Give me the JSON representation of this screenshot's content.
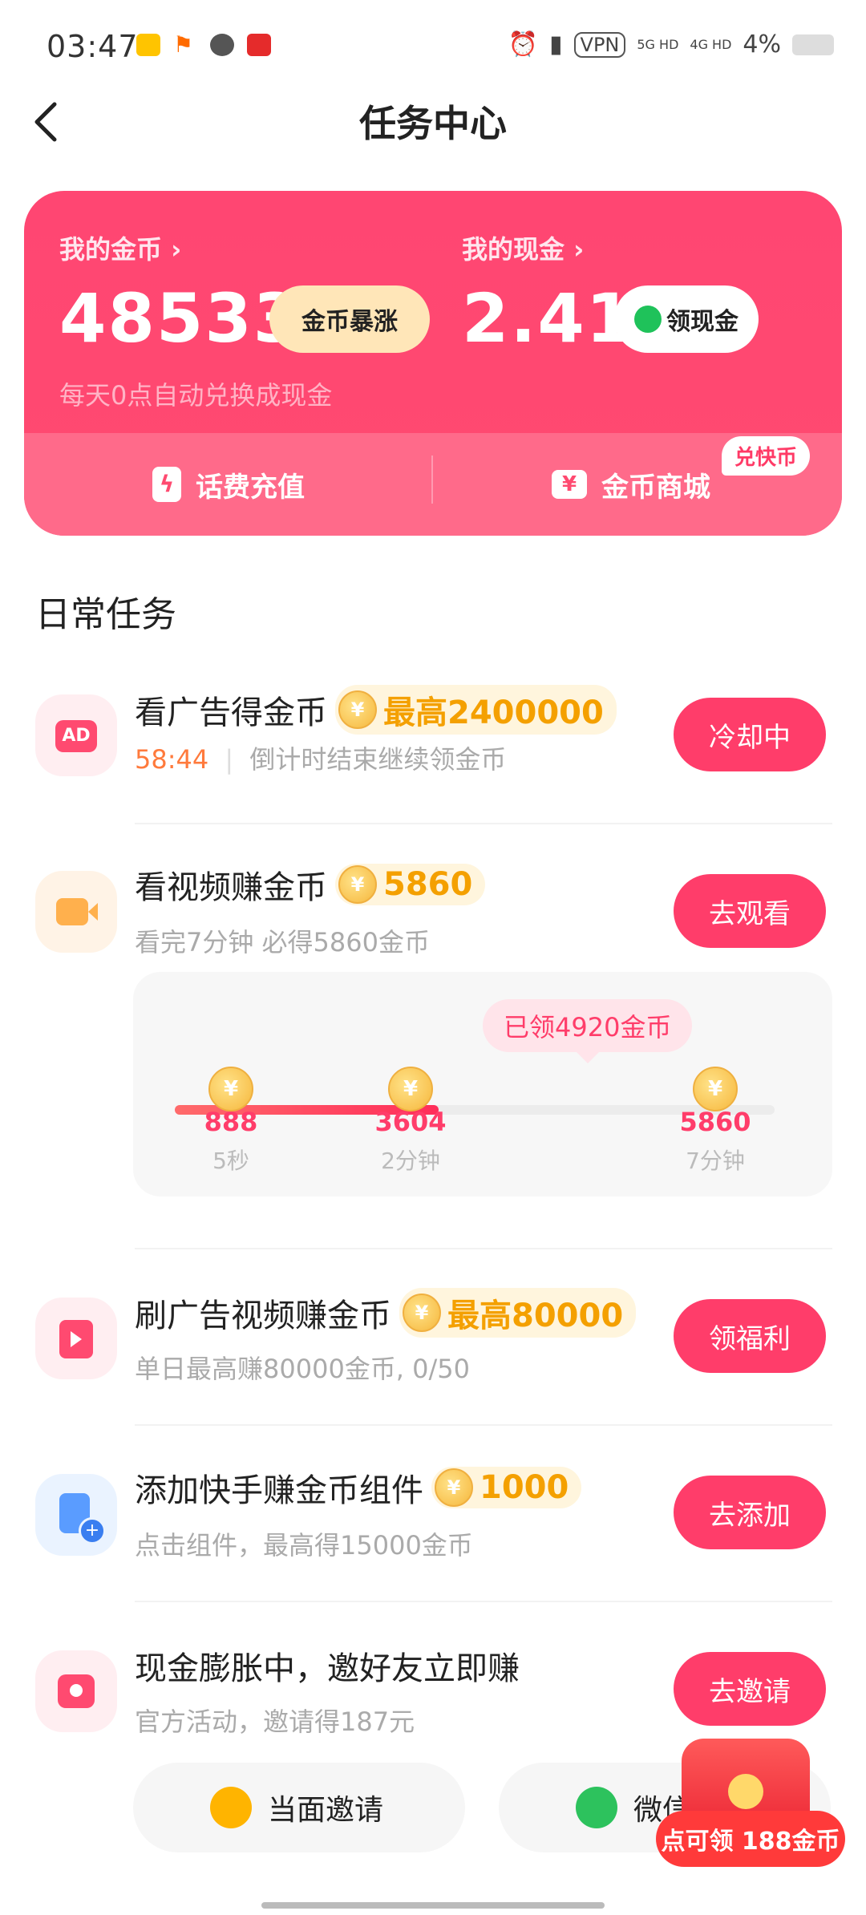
{
  "status_bar": {
    "time": "03:47",
    "network": "VPN",
    "signal_5g": "5G HD",
    "signal_4g": "4G HD",
    "battery": "4%"
  },
  "header": {
    "title": "任务中心"
  },
  "wallet": {
    "coins_label": "我的金币",
    "coins_value": "48533",
    "coins_pill": "金币暴涨",
    "cash_label": "我的现金",
    "cash_value": "2.41",
    "cash_pill": "领现金",
    "note": "每天0点自动兑换成现金",
    "recharge": "话费充值",
    "mall": "金币商城",
    "mall_badge": "兑快币"
  },
  "section_title": "日常任务",
  "tasks": [
    {
      "title": "看广告得金币",
      "reward": "最高2400000",
      "countdown": "58:44",
      "sub": "倒计时结束继续领金币",
      "button": "冷却中"
    },
    {
      "title": "看视频赚金币",
      "reward": "5860",
      "sub": "看完7分钟 必得5860金币",
      "button": "去观看"
    },
    {
      "title": "刷广告视频赚金币",
      "reward": "最高80000",
      "sub": "单日最高赚80000金币, 0/50",
      "button": "领福利"
    },
    {
      "title": "添加快手赚金币组件",
      "reward": "1000",
      "sub": "点击组件，最高得15000金币",
      "button": "去添加"
    },
    {
      "title": "现金膨胀中，邀好友立即赚",
      "sub": "官方活动，邀请得187元",
      "button": "去邀请"
    }
  ],
  "video_progress": {
    "bubble": "已领4920金币",
    "fill_fraction": 0.44,
    "milestones": [
      {
        "value": "888",
        "label": "5秒"
      },
      {
        "value": "3604",
        "label": "2分钟"
      },
      {
        "value": "5860",
        "label": "7分钟"
      }
    ]
  },
  "invite": {
    "face_to_face": "当面邀请",
    "wechat": "微信"
  },
  "floating": {
    "label": "点可领 188金币"
  },
  "colors": {
    "accent": "#ff3d6a",
    "gold": "#f4a000"
  }
}
